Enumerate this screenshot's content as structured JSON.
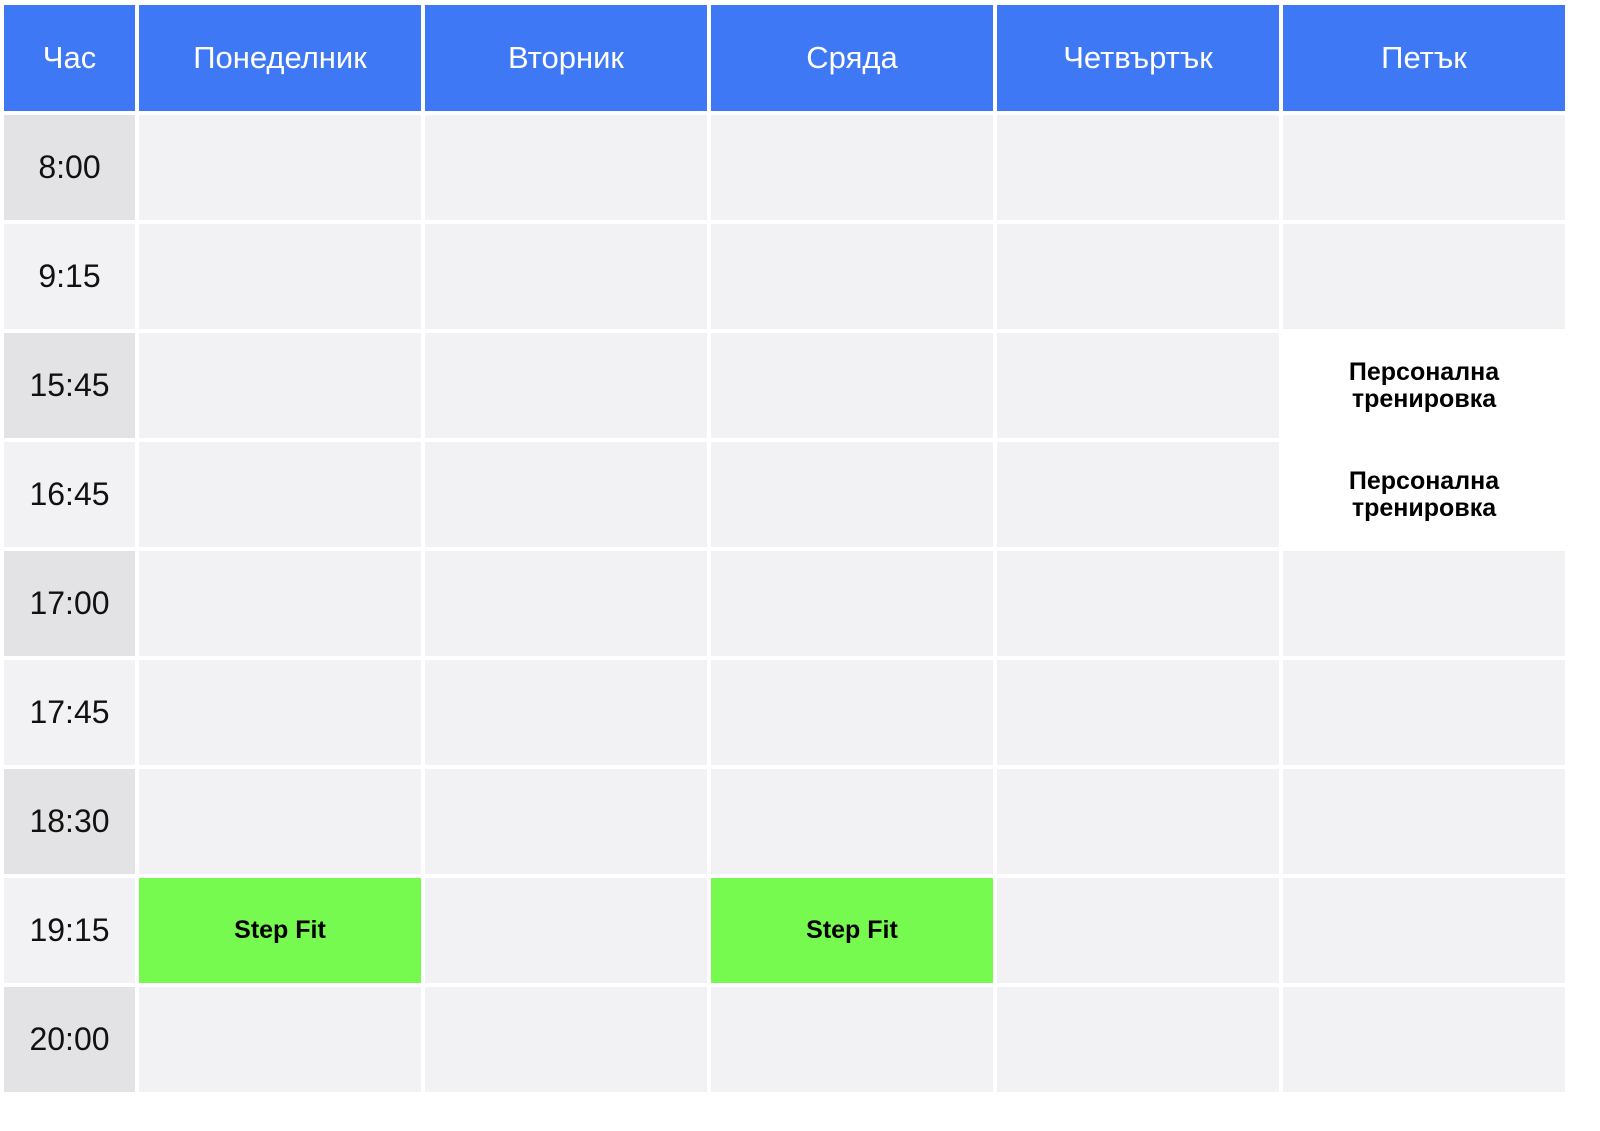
{
  "colors": {
    "header_bg": "#3f78f4",
    "header_text": "#ffffff",
    "cell_bg": "#f2f2f4",
    "time_bg_dark": "#e3e3e5",
    "event_green": "#77fa4f",
    "event_white": "#ffffff"
  },
  "header": {
    "time": "Час",
    "days": [
      "Понеделник",
      "Вторник",
      "Сряда",
      "Четвъртък",
      "Петък"
    ]
  },
  "rows": [
    {
      "time": "8:00",
      "cells": [
        "",
        "",
        "",
        "",
        ""
      ]
    },
    {
      "time": "9:15",
      "cells": [
        "",
        "",
        "",
        "",
        ""
      ]
    },
    {
      "time": "15:45",
      "cells": [
        "",
        "",
        "",
        "",
        "Персонална тренировка"
      ]
    },
    {
      "time": "16:45",
      "cells": [
        "",
        "",
        "",
        "",
        "Персонална тренировка"
      ]
    },
    {
      "time": "17:00",
      "cells": [
        "",
        "",
        "",
        "",
        ""
      ]
    },
    {
      "time": "17:45",
      "cells": [
        "",
        "",
        "",
        "",
        ""
      ]
    },
    {
      "time": "18:30",
      "cells": [
        "",
        "",
        "",
        "",
        ""
      ]
    },
    {
      "time": "19:15",
      "cells": [
        "Step Fit",
        "",
        "Step Fit",
        "",
        ""
      ]
    },
    {
      "time": "20:00",
      "cells": [
        "",
        "",
        "",
        "",
        ""
      ]
    }
  ]
}
